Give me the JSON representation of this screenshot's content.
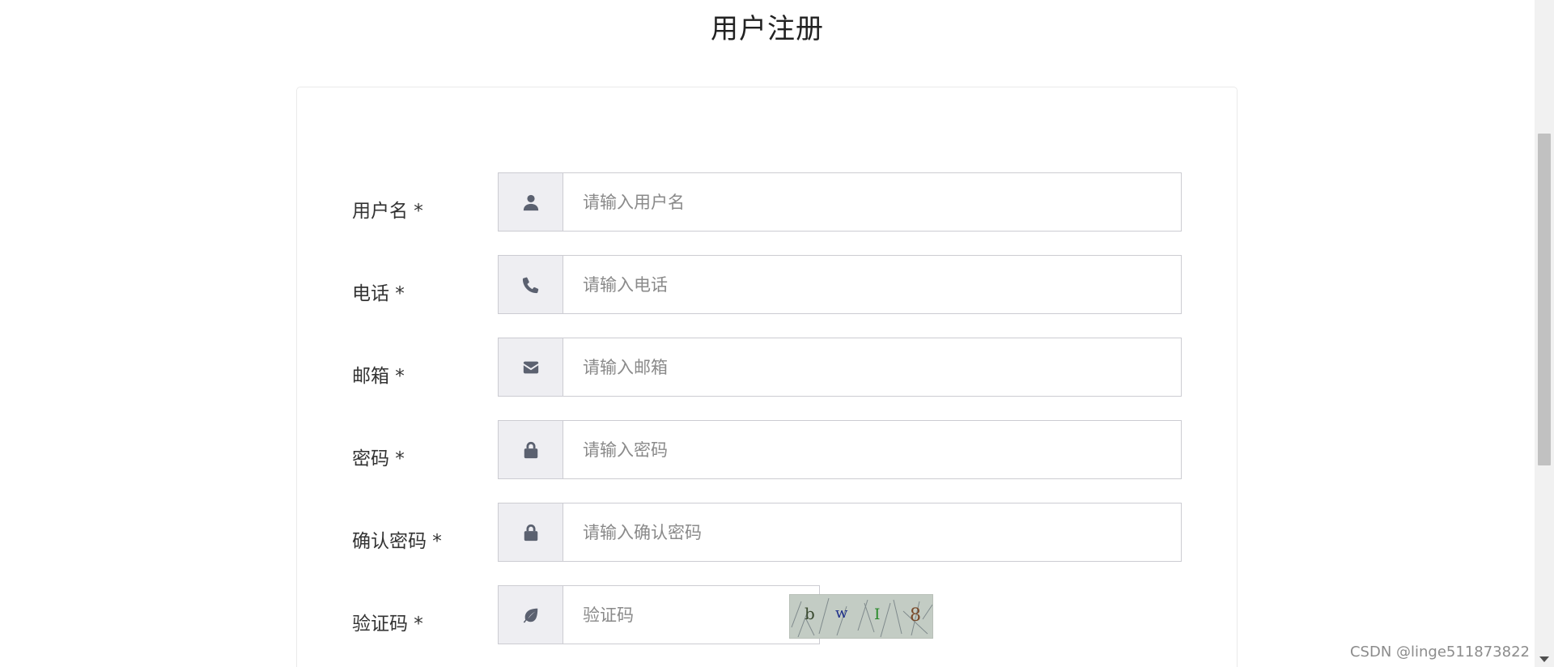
{
  "page": {
    "title": "用户注册"
  },
  "form": {
    "fields": [
      {
        "label": "用户名 *",
        "icon": "user-icon",
        "placeholder": "请输入用户名",
        "value": ""
      },
      {
        "label": "电话 *",
        "icon": "phone-icon",
        "placeholder": "请输入电话",
        "value": ""
      },
      {
        "label": "邮箱 *",
        "icon": "envelope-icon",
        "placeholder": "请输入邮箱",
        "value": ""
      },
      {
        "label": "密码 *",
        "icon": "lock-icon",
        "placeholder": "请输入密码",
        "value": ""
      },
      {
        "label": "确认密码 *",
        "icon": "lock-icon",
        "placeholder": "请输入确认密码",
        "value": ""
      },
      {
        "label": "验证码 *",
        "icon": "leaf-icon",
        "placeholder": "验证码",
        "value": ""
      }
    ],
    "captcha": {
      "text": "bwI8"
    }
  },
  "watermark": "CSDN @linge511873822",
  "colors": {
    "addon_bg": "#eeeef2",
    "border": "#ccccd2",
    "icon": "#5b6170"
  }
}
